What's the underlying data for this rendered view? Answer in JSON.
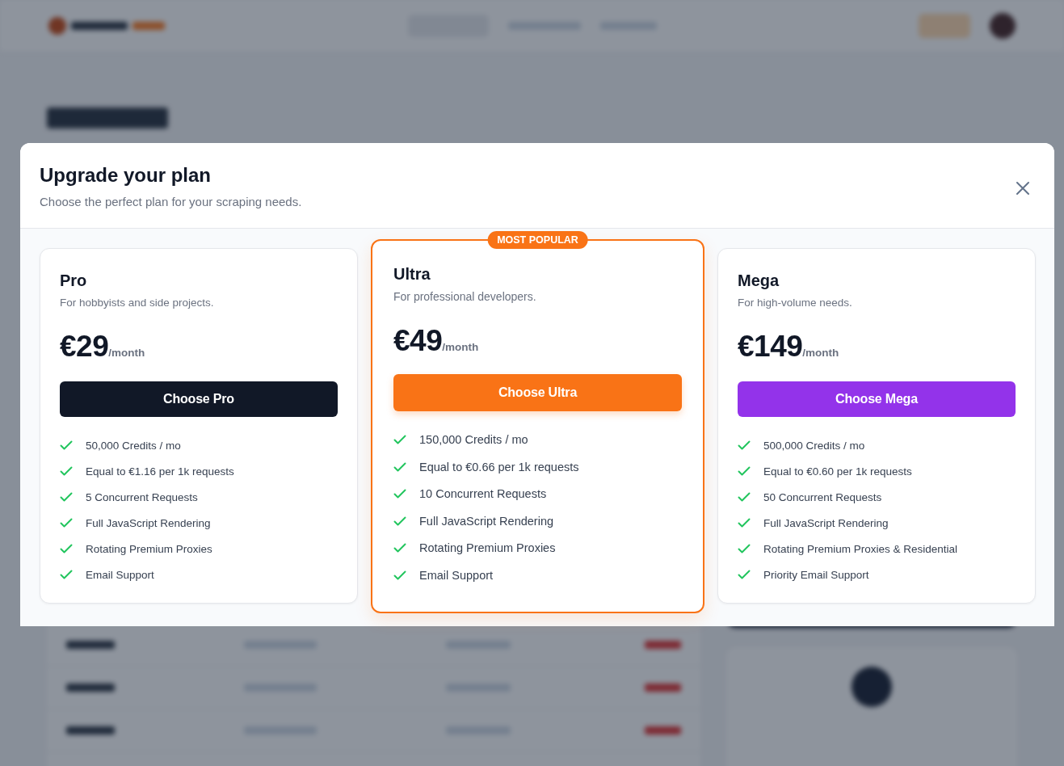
{
  "modal": {
    "title": "Upgrade your plan",
    "subtitle": "Choose the perfect plan for your scraping needs.",
    "plans": [
      {
        "name": "Pro",
        "description": "For hobbyists and side projects.",
        "price": "€29",
        "period": "/month",
        "button": "Choose Pro",
        "color": "#111827",
        "featured": false,
        "features": [
          "50,000 Credits / mo",
          "Equal to €1.16 per 1k requests",
          "5 Concurrent Requests",
          "Full JavaScript Rendering",
          "Rotating Premium Proxies",
          "Email Support"
        ]
      },
      {
        "name": "Ultra",
        "description": "For professional developers.",
        "price": "€49",
        "period": "/month",
        "button": "Choose Ultra",
        "color": "#f97316",
        "featured": true,
        "badge": "MOST POPULAR",
        "features": [
          "150,000 Credits / mo",
          "Equal to €0.66 per 1k requests",
          "10 Concurrent Requests",
          "Full JavaScript Rendering",
          "Rotating Premium Proxies",
          "Email Support"
        ]
      },
      {
        "name": "Mega",
        "description": "For high-volume needs.",
        "price": "€149",
        "period": "/month",
        "button": "Choose Mega",
        "color": "#9333ea",
        "featured": false,
        "features": [
          "500,000 Credits / mo",
          "Equal to €0.60 per 1k requests",
          "50 Concurrent Requests",
          "Full JavaScript Rendering",
          "Rotating Premium Proxies & Residential",
          "Priority Email Support"
        ]
      }
    ]
  }
}
